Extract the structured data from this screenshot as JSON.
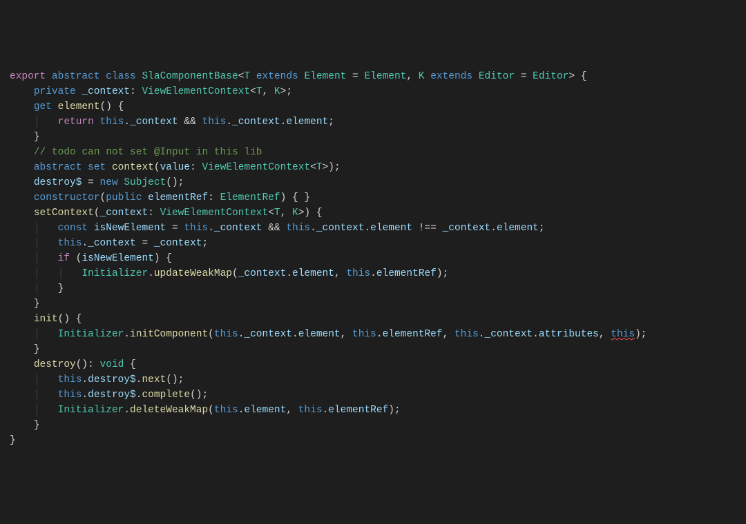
{
  "code": {
    "lines": [
      {
        "indent": 0,
        "tokens": [
          {
            "c": "kw-export",
            "t": "export"
          },
          {
            "c": "punct",
            "t": " "
          },
          {
            "c": "kw-abstract",
            "t": "abstract"
          },
          {
            "c": "punct",
            "t": " "
          },
          {
            "c": "kw-class",
            "t": "class"
          },
          {
            "c": "punct",
            "t": " "
          },
          {
            "c": "classname",
            "t": "SlaComponentBase"
          },
          {
            "c": "punct",
            "t": "<"
          },
          {
            "c": "type",
            "t": "T"
          },
          {
            "c": "punct",
            "t": " "
          },
          {
            "c": "kw-extends",
            "t": "extends"
          },
          {
            "c": "punct",
            "t": " "
          },
          {
            "c": "type",
            "t": "Element"
          },
          {
            "c": "punct",
            "t": " = "
          },
          {
            "c": "type",
            "t": "Element"
          },
          {
            "c": "punct",
            "t": ", "
          },
          {
            "c": "type",
            "t": "K"
          },
          {
            "c": "punct",
            "t": " "
          },
          {
            "c": "kw-extends",
            "t": "extends"
          },
          {
            "c": "punct",
            "t": " "
          },
          {
            "c": "type",
            "t": "Editor"
          },
          {
            "c": "punct",
            "t": " = "
          },
          {
            "c": "type",
            "t": "Editor"
          },
          {
            "c": "punct",
            "t": "> {"
          }
        ]
      },
      {
        "indent": 1,
        "tokens": [
          {
            "c": "kw-private",
            "t": "private"
          },
          {
            "c": "punct",
            "t": " "
          },
          {
            "c": "ident",
            "t": "_context"
          },
          {
            "c": "punct",
            "t": ": "
          },
          {
            "c": "type",
            "t": "ViewElementContext"
          },
          {
            "c": "punct",
            "t": "<"
          },
          {
            "c": "type",
            "t": "T"
          },
          {
            "c": "punct",
            "t": ", "
          },
          {
            "c": "type",
            "t": "K"
          },
          {
            "c": "punct",
            "t": ">;"
          }
        ]
      },
      {
        "indent": 0,
        "tokens": [
          {
            "c": "punct",
            "t": ""
          }
        ]
      },
      {
        "indent": 1,
        "tokens": [
          {
            "c": "kw-get",
            "t": "get"
          },
          {
            "c": "punct",
            "t": " "
          },
          {
            "c": "fn",
            "t": "element"
          },
          {
            "c": "punct",
            "t": "() {"
          }
        ]
      },
      {
        "indent": 2,
        "guides": [
          1
        ],
        "tokens": [
          {
            "c": "kw-return",
            "t": "return"
          },
          {
            "c": "punct",
            "t": " "
          },
          {
            "c": "kw-this",
            "t": "this"
          },
          {
            "c": "punct",
            "t": "."
          },
          {
            "c": "prop",
            "t": "_context"
          },
          {
            "c": "punct",
            "t": " && "
          },
          {
            "c": "kw-this",
            "t": "this"
          },
          {
            "c": "punct",
            "t": "."
          },
          {
            "c": "prop",
            "t": "_context"
          },
          {
            "c": "punct",
            "t": "."
          },
          {
            "c": "prop",
            "t": "element"
          },
          {
            "c": "punct",
            "t": ";"
          }
        ]
      },
      {
        "indent": 1,
        "tokens": [
          {
            "c": "punct",
            "t": "}"
          }
        ]
      },
      {
        "indent": 0,
        "tokens": [
          {
            "c": "punct",
            "t": ""
          }
        ]
      },
      {
        "indent": 1,
        "tokens": [
          {
            "c": "comment",
            "t": "// todo can not set @Input in this lib"
          }
        ]
      },
      {
        "indent": 1,
        "tokens": [
          {
            "c": "kw-abstract",
            "t": "abstract"
          },
          {
            "c": "punct",
            "t": " "
          },
          {
            "c": "kw-set",
            "t": "set"
          },
          {
            "c": "punct",
            "t": " "
          },
          {
            "c": "fn",
            "t": "context"
          },
          {
            "c": "punct",
            "t": "("
          },
          {
            "c": "ident",
            "t": "value"
          },
          {
            "c": "punct",
            "t": ": "
          },
          {
            "c": "type",
            "t": "ViewElementContext"
          },
          {
            "c": "punct",
            "t": "<"
          },
          {
            "c": "type",
            "t": "T"
          },
          {
            "c": "punct",
            "t": ">);"
          }
        ]
      },
      {
        "indent": 0,
        "tokens": [
          {
            "c": "punct",
            "t": ""
          }
        ]
      },
      {
        "indent": 1,
        "tokens": [
          {
            "c": "ident",
            "t": "destroy$"
          },
          {
            "c": "punct",
            "t": " = "
          },
          {
            "c": "kw-new",
            "t": "new"
          },
          {
            "c": "punct",
            "t": " "
          },
          {
            "c": "classname",
            "t": "Subject"
          },
          {
            "c": "punct",
            "t": "();"
          }
        ]
      },
      {
        "indent": 0,
        "tokens": [
          {
            "c": "punct",
            "t": ""
          }
        ]
      },
      {
        "indent": 1,
        "tokens": [
          {
            "c": "kw-abstract",
            "t": "constructor"
          },
          {
            "c": "punct",
            "t": "("
          },
          {
            "c": "kw-public",
            "t": "public"
          },
          {
            "c": "punct",
            "t": " "
          },
          {
            "c": "ident",
            "t": "elementRef"
          },
          {
            "c": "punct",
            "t": ": "
          },
          {
            "c": "type",
            "t": "ElementRef"
          },
          {
            "c": "punct",
            "t": ") { }"
          }
        ]
      },
      {
        "indent": 0,
        "tokens": [
          {
            "c": "punct",
            "t": ""
          }
        ]
      },
      {
        "indent": 1,
        "tokens": [
          {
            "c": "fn",
            "t": "setContext"
          },
          {
            "c": "punct",
            "t": "("
          },
          {
            "c": "ident",
            "t": "_context"
          },
          {
            "c": "punct",
            "t": ": "
          },
          {
            "c": "type",
            "t": "ViewElementContext"
          },
          {
            "c": "punct",
            "t": "<"
          },
          {
            "c": "type",
            "t": "T"
          },
          {
            "c": "punct",
            "t": ", "
          },
          {
            "c": "type",
            "t": "K"
          },
          {
            "c": "punct",
            "t": ">) {"
          }
        ]
      },
      {
        "indent": 2,
        "guides": [
          1
        ],
        "tokens": [
          {
            "c": "kw-const",
            "t": "const"
          },
          {
            "c": "punct",
            "t": " "
          },
          {
            "c": "ident",
            "t": "isNewElement"
          },
          {
            "c": "punct",
            "t": " = "
          },
          {
            "c": "kw-this",
            "t": "this"
          },
          {
            "c": "punct",
            "t": "."
          },
          {
            "c": "prop",
            "t": "_context"
          },
          {
            "c": "punct",
            "t": " && "
          },
          {
            "c": "kw-this",
            "t": "this"
          },
          {
            "c": "punct",
            "t": "."
          },
          {
            "c": "prop",
            "t": "_context"
          },
          {
            "c": "punct",
            "t": "."
          },
          {
            "c": "prop",
            "t": "element"
          },
          {
            "c": "punct",
            "t": " !== "
          },
          {
            "c": "ident",
            "t": "_context"
          },
          {
            "c": "punct",
            "t": "."
          },
          {
            "c": "prop",
            "t": "element"
          },
          {
            "c": "punct",
            "t": ";"
          }
        ]
      },
      {
        "indent": 2,
        "guides": [
          1
        ],
        "tokens": [
          {
            "c": "kw-this",
            "t": "this"
          },
          {
            "c": "punct",
            "t": "."
          },
          {
            "c": "prop",
            "t": "_context"
          },
          {
            "c": "punct",
            "t": " = "
          },
          {
            "c": "ident",
            "t": "_context"
          },
          {
            "c": "punct",
            "t": ";"
          }
        ]
      },
      {
        "indent": 2,
        "guides": [
          1
        ],
        "tokens": [
          {
            "c": "kw-if",
            "t": "if"
          },
          {
            "c": "punct",
            "t": " ("
          },
          {
            "c": "ident",
            "t": "isNewElement"
          },
          {
            "c": "punct",
            "t": ") {"
          }
        ]
      },
      {
        "indent": 3,
        "guides": [
          1,
          2
        ],
        "tokens": [
          {
            "c": "classname",
            "t": "Initializer"
          },
          {
            "c": "punct",
            "t": "."
          },
          {
            "c": "fn",
            "t": "updateWeakMap"
          },
          {
            "c": "punct",
            "t": "("
          },
          {
            "c": "ident",
            "t": "_context"
          },
          {
            "c": "punct",
            "t": "."
          },
          {
            "c": "prop",
            "t": "element"
          },
          {
            "c": "punct",
            "t": ", "
          },
          {
            "c": "kw-this",
            "t": "this"
          },
          {
            "c": "punct",
            "t": "."
          },
          {
            "c": "prop",
            "t": "elementRef"
          },
          {
            "c": "punct",
            "t": ");"
          }
        ]
      },
      {
        "indent": 2,
        "guides": [
          1
        ],
        "tokens": [
          {
            "c": "punct",
            "t": "}"
          }
        ]
      },
      {
        "indent": 1,
        "tokens": [
          {
            "c": "punct",
            "t": "}"
          }
        ]
      },
      {
        "indent": 0,
        "tokens": [
          {
            "c": "punct",
            "t": ""
          }
        ]
      },
      {
        "indent": 1,
        "tokens": [
          {
            "c": "fn",
            "t": "init"
          },
          {
            "c": "punct",
            "t": "() {"
          }
        ]
      },
      {
        "indent": 2,
        "guides": [
          1
        ],
        "tokens": [
          {
            "c": "classname",
            "t": "Initializer"
          },
          {
            "c": "punct",
            "t": "."
          },
          {
            "c": "fn",
            "t": "initComponent"
          },
          {
            "c": "punct",
            "t": "("
          },
          {
            "c": "kw-this",
            "t": "this"
          },
          {
            "c": "punct",
            "t": "."
          },
          {
            "c": "prop",
            "t": "_context"
          },
          {
            "c": "punct",
            "t": "."
          },
          {
            "c": "prop",
            "t": "element"
          },
          {
            "c": "punct",
            "t": ", "
          },
          {
            "c": "kw-this",
            "t": "this"
          },
          {
            "c": "punct",
            "t": "."
          },
          {
            "c": "prop",
            "t": "elementRef"
          },
          {
            "c": "punct",
            "t": ", "
          },
          {
            "c": "kw-this",
            "t": "this"
          },
          {
            "c": "punct",
            "t": "."
          },
          {
            "c": "prop",
            "t": "_context"
          },
          {
            "c": "punct",
            "t": "."
          },
          {
            "c": "prop",
            "t": "attributes"
          },
          {
            "c": "punct",
            "t": ", "
          },
          {
            "c": "kw-this squiggle",
            "t": "this"
          },
          {
            "c": "punct",
            "t": ");"
          }
        ]
      },
      {
        "indent": 1,
        "tokens": [
          {
            "c": "punct",
            "t": "}"
          }
        ]
      },
      {
        "indent": 0,
        "tokens": [
          {
            "c": "punct",
            "t": ""
          }
        ]
      },
      {
        "indent": 1,
        "tokens": [
          {
            "c": "fn",
            "t": "destroy"
          },
          {
            "c": "punct",
            "t": "(): "
          },
          {
            "c": "kw-void",
            "t": "void"
          },
          {
            "c": "punct",
            "t": " {"
          }
        ]
      },
      {
        "indent": 2,
        "guides": [
          1
        ],
        "tokens": [
          {
            "c": "kw-this",
            "t": "this"
          },
          {
            "c": "punct",
            "t": "."
          },
          {
            "c": "prop",
            "t": "destroy$"
          },
          {
            "c": "punct",
            "t": "."
          },
          {
            "c": "fn",
            "t": "next"
          },
          {
            "c": "punct",
            "t": "();"
          }
        ]
      },
      {
        "indent": 2,
        "guides": [
          1
        ],
        "tokens": [
          {
            "c": "kw-this",
            "t": "this"
          },
          {
            "c": "punct",
            "t": "."
          },
          {
            "c": "prop",
            "t": "destroy$"
          },
          {
            "c": "punct",
            "t": "."
          },
          {
            "c": "fn",
            "t": "complete"
          },
          {
            "c": "punct",
            "t": "();"
          }
        ]
      },
      {
        "indent": 2,
        "guides": [
          1
        ],
        "tokens": [
          {
            "c": "classname",
            "t": "Initializer"
          },
          {
            "c": "punct",
            "t": "."
          },
          {
            "c": "fn",
            "t": "deleteWeakMap"
          },
          {
            "c": "punct",
            "t": "("
          },
          {
            "c": "kw-this",
            "t": "this"
          },
          {
            "c": "punct",
            "t": "."
          },
          {
            "c": "prop",
            "t": "element"
          },
          {
            "c": "punct",
            "t": ", "
          },
          {
            "c": "kw-this",
            "t": "this"
          },
          {
            "c": "punct",
            "t": "."
          },
          {
            "c": "prop",
            "t": "elementRef"
          },
          {
            "c": "punct",
            "t": ");"
          }
        ]
      },
      {
        "indent": 1,
        "tokens": [
          {
            "c": "punct",
            "t": "}"
          }
        ]
      },
      {
        "indent": 0,
        "tokens": [
          {
            "c": "punct",
            "t": "}"
          }
        ]
      }
    ],
    "indentUnit": "    ",
    "guideChar": "│"
  }
}
